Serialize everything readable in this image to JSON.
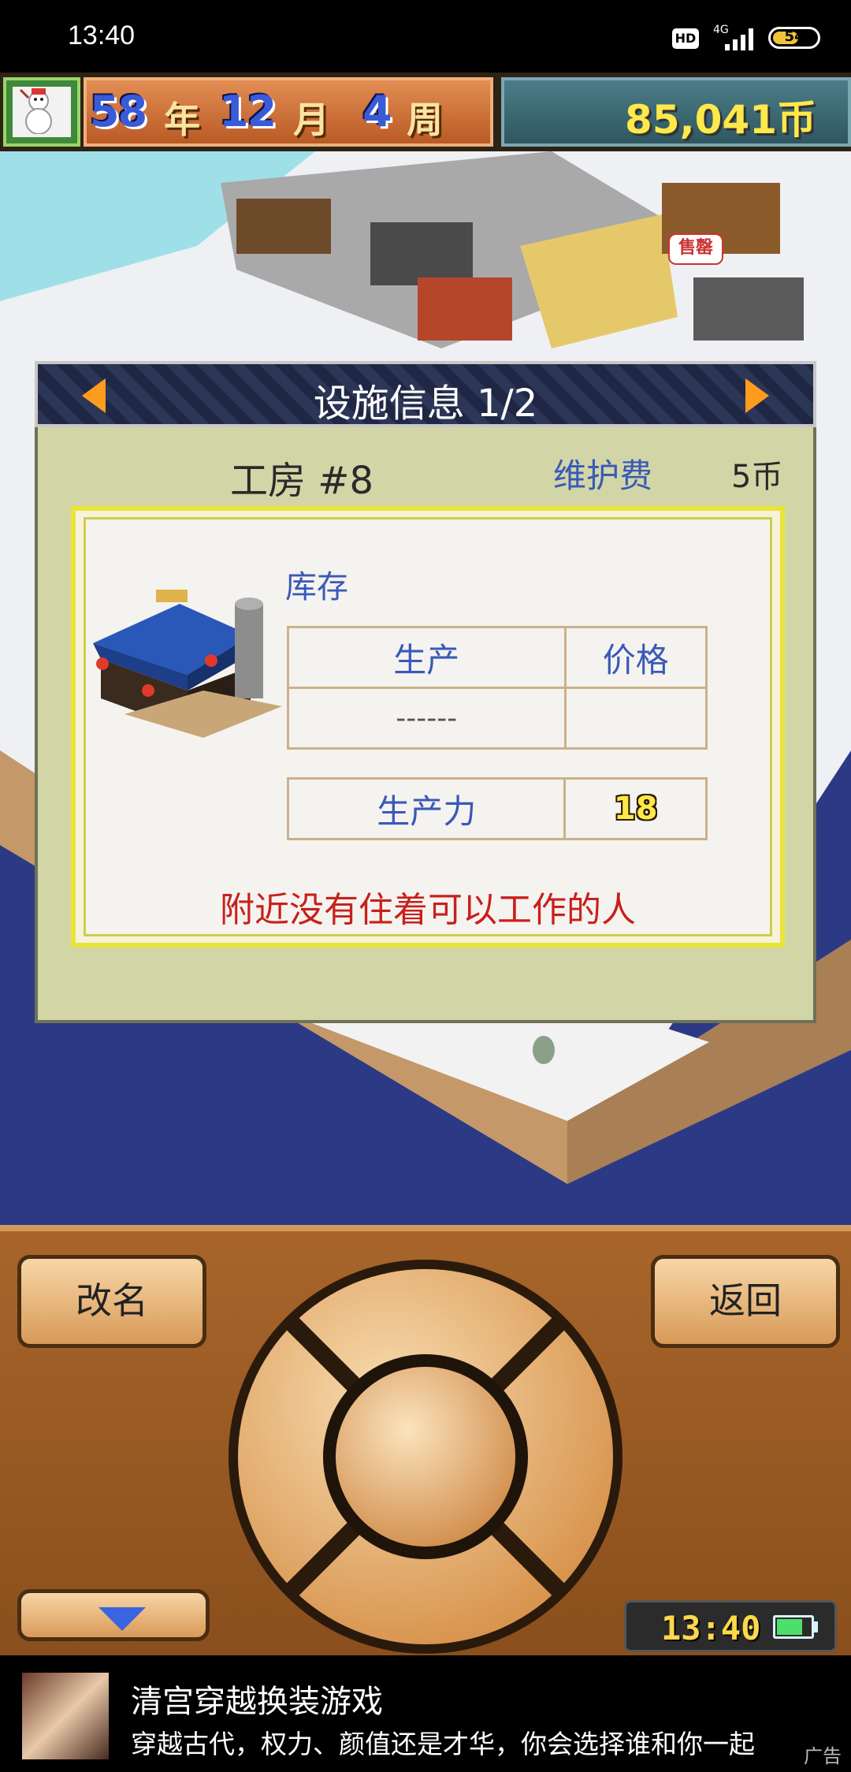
{
  "status_bar": {
    "time": "13:40",
    "hd": "HD",
    "network": "4G",
    "battery": "54"
  },
  "game_header": {
    "year": "58",
    "year_unit": "年",
    "month": "12",
    "month_unit": "月",
    "week": "4",
    "week_unit": "周",
    "money": "85,041币"
  },
  "map": {
    "shop_sign": "售罄"
  },
  "panel": {
    "title": "设施信息 1/2",
    "facility_name": "工房 #8",
    "maintenance_label": "维护费",
    "maintenance_value": "5币",
    "stock_label": "库存",
    "table": {
      "headers": [
        "生产",
        "价格"
      ],
      "rows": [
        [
          "------",
          ""
        ]
      ]
    },
    "capacity_label": "生产力",
    "capacity_value": "18",
    "warning": "附近没有住着可以工作的人"
  },
  "controls": {
    "rename_label": "改名",
    "back_label": "返回",
    "clock": "13:40",
    "battery_level": 0.7
  },
  "ad": {
    "title": "清宫穿越换装游戏",
    "description": "穿越古代，权力、颜值还是才华，你会选择谁和你一起",
    "tag": "广告"
  },
  "colors": {
    "accent_blue": "#3a59b8",
    "warning_red": "#c8201c",
    "money_yellow": "#ffe94a"
  }
}
